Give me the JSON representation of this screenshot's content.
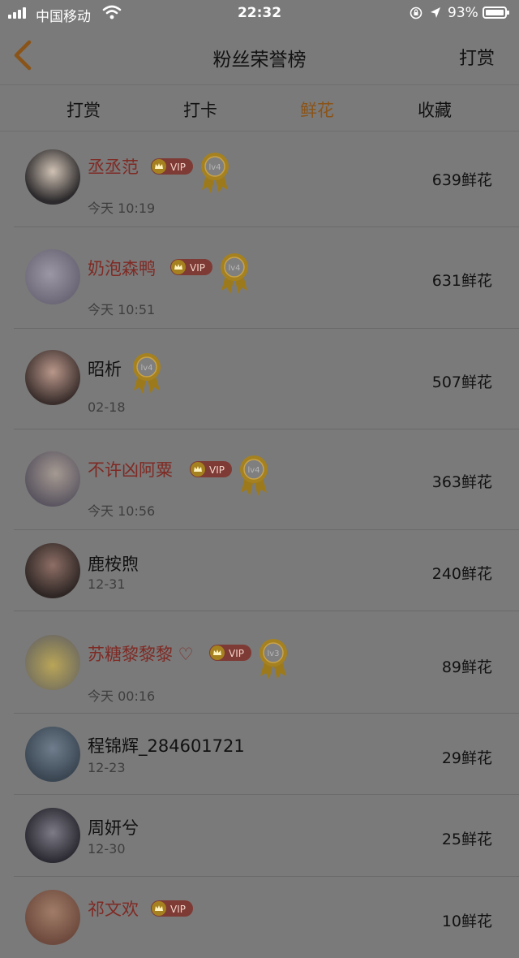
{
  "status_bar": {
    "carrier": "中国移动",
    "time": "22:32",
    "battery": "93%"
  },
  "header": {
    "title": "粉丝荣誉榜",
    "reward_label": "打赏"
  },
  "tabs": [
    {
      "label": "打赏",
      "active": false
    },
    {
      "label": "打卡",
      "active": false
    },
    {
      "label": "鲜花",
      "active": true
    },
    {
      "label": "收藏",
      "active": false
    }
  ],
  "vip_label": "VIP",
  "fans": [
    {
      "name": "丞丞范",
      "time": "今天 10:19",
      "count": "639鲜花",
      "vip": true,
      "level": "lv4"
    },
    {
      "name": "奶泡森鸭",
      "time": "今天 10:51",
      "count": "631鲜花",
      "vip": true,
      "level": "lv4"
    },
    {
      "name": "昭析",
      "time": "02-18",
      "count": "507鲜花",
      "vip": false,
      "level": "lv4"
    },
    {
      "name": "不许凶阿粟",
      "time": "今天 10:56",
      "count": "363鲜花",
      "vip": true,
      "level": "lv4"
    },
    {
      "name": "鹿桉煦",
      "time": "12-31",
      "count": "240鲜花",
      "vip": false,
      "level": ""
    },
    {
      "name": "苏糖黎黎黎 ♡",
      "time": "今天 00:16",
      "count": "89鲜花",
      "vip": true,
      "level": "lv3"
    },
    {
      "name": "程锦辉_284601721",
      "time": "12-23",
      "count": "29鲜花",
      "vip": false,
      "level": ""
    },
    {
      "name": "周妍兮",
      "time": "12-30",
      "count": "25鲜花",
      "vip": false,
      "level": ""
    },
    {
      "name": "祁文欢",
      "time": "",
      "count": "10鲜花",
      "vip": true,
      "level": ""
    }
  ],
  "colors": {
    "overlay_bg": "#7a7a7a",
    "active_tab": "#8a5419",
    "vip_name": "#7f2a24",
    "medal_gold": "#a5811f"
  }
}
